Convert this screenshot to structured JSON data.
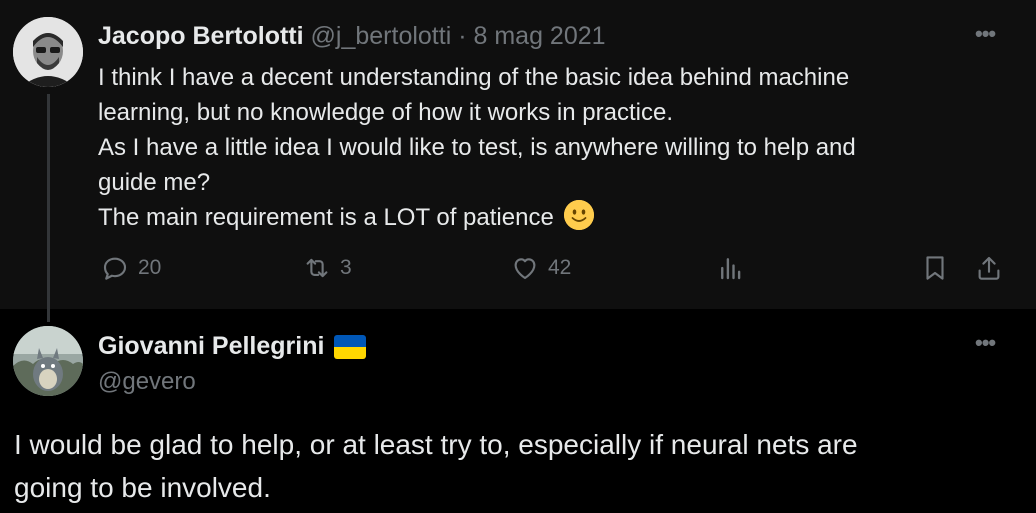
{
  "tweet": {
    "author_name": "Jacopo Bertolotti",
    "author_handle": "@j_bertolotti",
    "separator": " · ",
    "date": "8 mag 2021",
    "lines": [
      "I think I have a decent understanding of the basic idea behind machine",
      "learning, but no knowledge of how it works in practice.",
      "As I have a little idea I would like to test, is anywhere willing to help and",
      "guide me?",
      "The main requirement is a LOT of patience"
    ],
    "emoji": "slightly-smiling-face",
    "more_label": "•••",
    "actions": {
      "replies": "20",
      "reposts": "3",
      "likes": "42"
    }
  },
  "reply": {
    "author_name": "Giovanni Pellegrini",
    "author_flag": "ukraine-flag",
    "author_handle": "@gevero",
    "more_label": "•••",
    "lines": [
      "I would be glad to help, or at least try to, especially if neural nets are",
      "going to be involved."
    ]
  },
  "colors": {
    "background": "#000000",
    "parent_background": "#0f0f0f",
    "text": "#e7e9ea",
    "muted": "#71767b",
    "thread_line": "#333639"
  }
}
